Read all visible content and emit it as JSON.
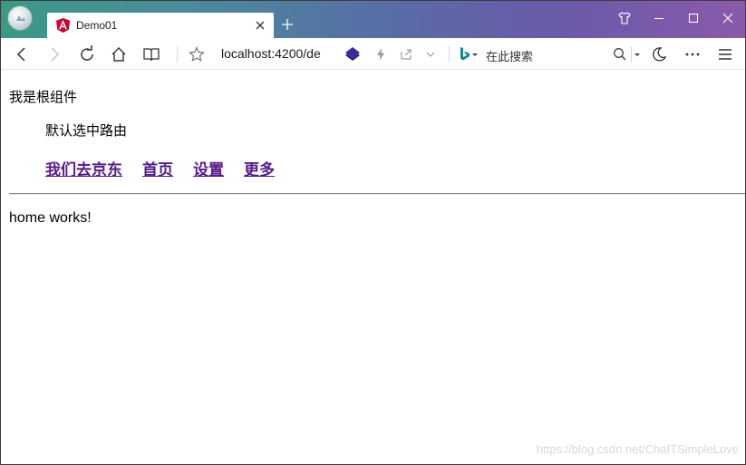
{
  "browser": {
    "tab": {
      "title": "Demo01",
      "favicon": "angular-logo-icon"
    },
    "address": "localhost:4200/de",
    "search_placeholder": "在此搜索",
    "colors": {
      "titlebar_start": "#3a9a86",
      "titlebar_end": "#8a5aaa"
    }
  },
  "page": {
    "root_text": "我是根组件",
    "default_route_text": "默认选中路由",
    "nav_links": [
      {
        "label": "我们去京东"
      },
      {
        "label": "首页"
      },
      {
        "label": "设置"
      },
      {
        "label": "更多"
      }
    ],
    "link_color": "#551a8b",
    "home_text": "home works!"
  },
  "watermark": "https://blog.csdn.net/ChaITSimpleLove"
}
